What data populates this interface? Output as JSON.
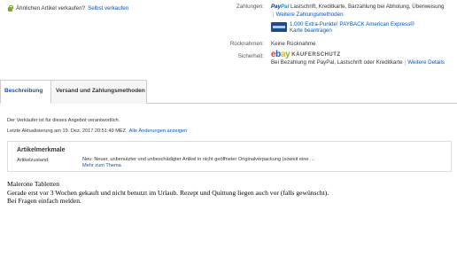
{
  "sell": {
    "label": "Ähnlichen Artikel verkaufen?",
    "link": "Selbst verkaufen"
  },
  "info": {
    "payments_label": "Zahlungen:",
    "paypal_logo_1": "Pay",
    "paypal_logo_2": "Pal",
    "payments_methods": "Lastschrift, Kreditkarte, Barzahlung bei Abholung, Überweisung",
    "payments_more": "Weitere Zahlungsmethoden",
    "payback_line1": "1.000 Extra-Punkte! PAYBACK American Express®",
    "payback_line2": "Karte beantragen",
    "returns_label": "Rücknahmen:",
    "returns_value": "Keine Rücknahme",
    "security_label": "Sicherheit:",
    "ebay_letters": [
      "e",
      "b",
      "a",
      "y"
    ],
    "kaeuferschutz": "KÄUFERSCHUTZ",
    "security_text": "Bei Bezahlung mit PayPal, Lastschrift oder Kreditkarte",
    "security_more": "Weitere Details"
  },
  "tabs": [
    {
      "label": "Beschreibung",
      "active": true
    },
    {
      "label": "Versand und Zahlungsmethoden",
      "active": false
    }
  ],
  "description": {
    "seller_note": "Der Verkäufer ist für dieses Angebot verantwortlich.",
    "updated_label": "Letzte Aktualisierung am",
    "updated_value": "19. Dez. 2017 20:51:49 MEZ",
    "updated_link": "Alle Änderungen anzeigen",
    "specs_title": "Artikelmerkmale",
    "condition_label": "Artikelzustand:",
    "condition_value": "Neu: Neuer, unbenutzter und unbeschädigter Artikel in nicht geöffneter Originalverpackung (soweit eine ...",
    "condition_link": "Mehr zum Thema",
    "body_lines": [
      "Malerone Tabletten",
      "Gerade erst vor 3 Wochen gekauft und nicht benutzt im Urlaub. Rezept und Quittung liegen auch vor (falls gewünscht).",
      "Bei Fragen einfach melden."
    ]
  },
  "colors": {
    "link": "#0654ba",
    "paypal_dark": "#003087",
    "paypal_light": "#009cde",
    "ebay_red": "#e53238",
    "ebay_blue": "#0064d2",
    "ebay_yellow": "#f5af02",
    "ebay_green": "#86b817"
  }
}
